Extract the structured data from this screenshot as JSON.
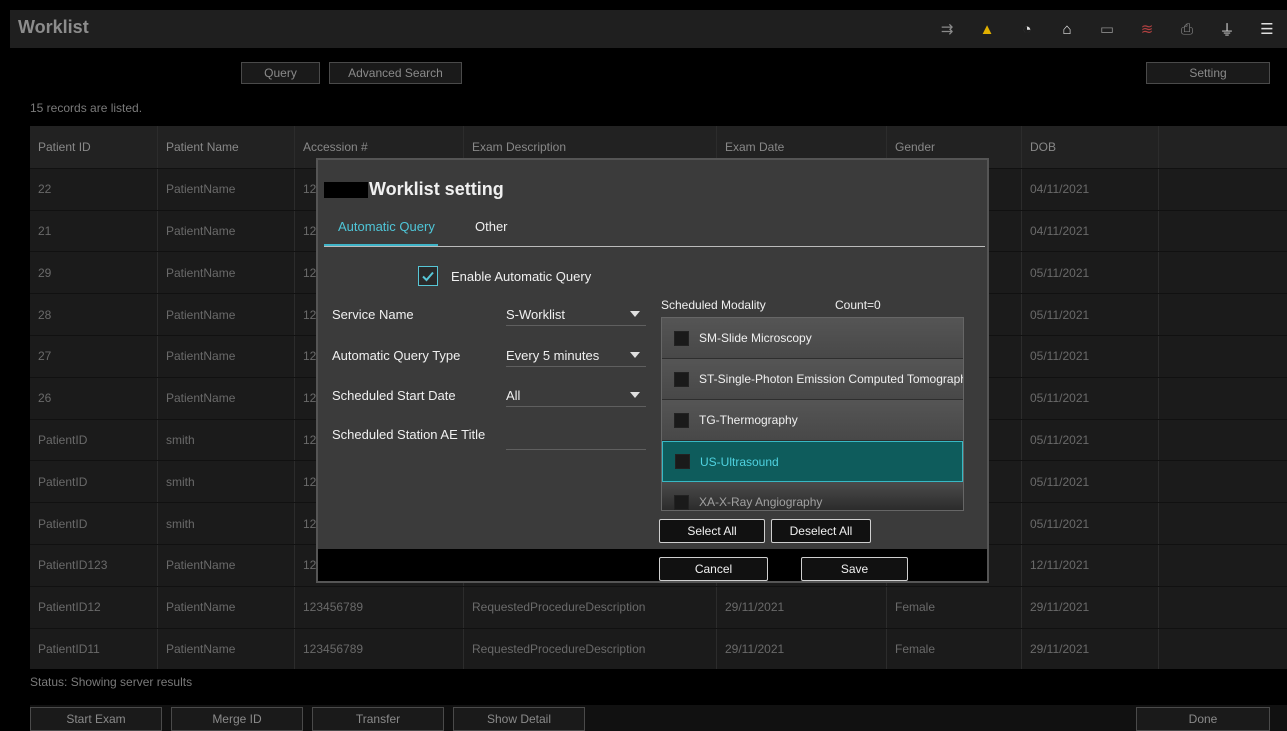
{
  "app": {
    "title": "Worklist"
  },
  "status_icons": [
    "transfer-icon",
    "warning-icon",
    "disk-icon",
    "mouse-icon",
    "battery-icon",
    "network-icon",
    "printer-icon",
    "usb-icon",
    "menu-icon"
  ],
  "toolbar": {
    "query": "Query",
    "advanced_search": "Advanced Search",
    "setting": "Setting"
  },
  "records_text": "15 records are listed.",
  "table": {
    "headers": [
      "Patient ID",
      "Patient Name",
      "Accession #",
      "Exam Description",
      "Exam Date",
      "Gender",
      "DOB",
      ""
    ],
    "rows": [
      [
        "22",
        "PatientName",
        "12",
        "",
        "",
        "",
        "04/11/2021",
        ""
      ],
      [
        "21",
        "PatientName",
        "12",
        "",
        "",
        "",
        "04/11/2021",
        ""
      ],
      [
        "29",
        "PatientName",
        "12",
        "",
        "",
        "",
        "05/11/2021",
        ""
      ],
      [
        "28",
        "PatientName",
        "12",
        "",
        "",
        "",
        "05/11/2021",
        ""
      ],
      [
        "27",
        "PatientName",
        "12",
        "",
        "",
        "",
        "05/11/2021",
        ""
      ],
      [
        "26",
        "PatientName",
        "12",
        "",
        "",
        "",
        "05/11/2021",
        ""
      ],
      [
        "PatientID",
        "smith",
        "12",
        "",
        "",
        "",
        "05/11/2021",
        ""
      ],
      [
        "PatientID",
        "smith",
        "12",
        "",
        "",
        "",
        "05/11/2021",
        ""
      ],
      [
        "PatientID",
        "smith",
        "12",
        "",
        "",
        "",
        "05/11/2021",
        ""
      ],
      [
        "PatientID123",
        "PatientName",
        "12",
        "",
        "",
        "",
        "12/11/2021",
        ""
      ],
      [
        "PatientID12",
        "PatientName",
        "123456789",
        "RequestedProcedureDescription",
        "29/11/2021",
        "Female",
        "29/11/2021",
        ""
      ],
      [
        "PatientID11",
        "PatientName",
        "123456789",
        "RequestedProcedureDescription",
        "29/11/2021",
        "Female",
        "29/11/2021",
        ""
      ]
    ]
  },
  "status_text": "Status: Showing server results",
  "bottom_buttons": {
    "start_exam": "Start Exam",
    "merge_id": "Merge ID",
    "transfer": "Transfer",
    "show_detail": "Show Detail",
    "done": "Done"
  },
  "dialog": {
    "title": "Worklist setting",
    "tabs": [
      "Automatic Query",
      "Other"
    ],
    "enable_label": "Enable Automatic Query",
    "enable_checked": true,
    "fields": {
      "service_name": {
        "label": "Service Name",
        "value": "S-Worklist"
      },
      "query_type": {
        "label": "Automatic Query Type",
        "value": "Every 5 minutes"
      },
      "start_date": {
        "label": "Scheduled Start Date",
        "value": "All"
      },
      "ae_title": {
        "label": "Scheduled Station AE Title",
        "value": ""
      }
    },
    "modality_header": "Scheduled Modality",
    "count_label": "Count=0",
    "modalities": [
      "SM-Slide Microscopy",
      "ST-Single-Photon Emission Computed Tomography",
      "TG-Thermography",
      "US-Ultrasound",
      "XA-X-Ray Angiography"
    ],
    "selected_modality": "US-Ultrasound",
    "select_all": "Select All",
    "deselect_all": "Deselect All",
    "cancel": "Cancel",
    "save": "Save"
  }
}
